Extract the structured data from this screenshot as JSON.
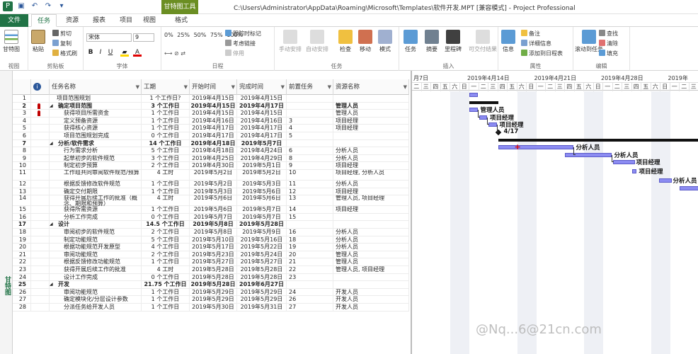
{
  "window": {
    "title": "C:\\Users\\Administrator\\AppData\\Roaming\\Microsoft\\Templates\\软件开发.MPT [兼容模式] - Project Professional",
    "context_tool": "甘特图工具"
  },
  "tabs": [
    {
      "label": "文件"
    },
    {
      "label": "任务"
    },
    {
      "label": "资源"
    },
    {
      "label": "报表"
    },
    {
      "label": "项目"
    },
    {
      "label": "视图"
    },
    {
      "label": "格式"
    }
  ],
  "ribbon": {
    "view": {
      "gantt_label": "甘特图",
      "group": "视图"
    },
    "clipboard": {
      "paste": "粘贴",
      "cut": "剪切",
      "copy": "复制",
      "format_painter": "格式刷",
      "group": "剪贴板"
    },
    "font": {
      "family": "宋体",
      "size": "9",
      "bold": "B",
      "italic": "I",
      "underline": "U",
      "group": "字体"
    },
    "schedule": {
      "pcts": [
        "0%",
        "25%",
        "50%",
        "75%",
        "100%"
      ],
      "track": "跟踪时标记",
      "respect_links": "考虑链接",
      "inactivate": "停用",
      "group": "日程"
    },
    "tasks": {
      "manual": "手动安排",
      "auto": "自动安排",
      "inspect": "检查",
      "move": "移动",
      "mode": "模式",
      "group": "任务"
    },
    "insert": {
      "task": "任务",
      "summary": "摘要",
      "milestone": "里程碑",
      "deliverable": "可交付结果",
      "group": "插入"
    },
    "properties": {
      "info": "信息",
      "notes": "备注",
      "details": "详细信息",
      "add_timeline": "添加到日程表",
      "group": "属性"
    },
    "editing": {
      "scroll": "滚动到任务",
      "find": "查找",
      "clear": "清除",
      "fill": "填充",
      "group": "编辑"
    }
  },
  "sidebar_label": "甘特图",
  "columns": [
    "任务名称",
    "工期",
    "开始时间",
    "完成时间",
    "前置任务",
    "资源名称"
  ],
  "rows": [
    {
      "id": "1",
      "name": "项目范围规划",
      "dur": "1 个工作日?",
      "start": "2019年4月15日",
      "finish": "2019年4月15日",
      "pred": "",
      "res": "",
      "lvl": 0,
      "sum": false
    },
    {
      "id": "2",
      "name": "确定项目范围",
      "dur": "3 个工作日",
      "start": "2019年4月15日",
      "finish": "2019年4月17日",
      "pred": "",
      "res": "管理人员",
      "lvl": 0,
      "sum": true,
      "ind": true
    },
    {
      "id": "3",
      "name": "获得项目所需资金",
      "dur": "1 个工作日",
      "start": "2019年4月15日",
      "finish": "2019年4月15日",
      "pred": "",
      "res": "管理人员",
      "lvl": 1,
      "sum": false,
      "ind": true
    },
    {
      "id": "4",
      "name": "定义预备资源",
      "dur": "1 个工作日",
      "start": "2019年4月16日",
      "finish": "2019年4月16日",
      "pred": "3",
      "res": "项目经理",
      "lvl": 1,
      "sum": false
    },
    {
      "id": "5",
      "name": "获得核心资源",
      "dur": "1 个工作日",
      "start": "2019年4月17日",
      "finish": "2019年4月17日",
      "pred": "4",
      "res": "项目经理",
      "lvl": 1,
      "sum": false
    },
    {
      "id": "6",
      "name": "项目范围规划完成",
      "dur": "0 个工作日",
      "start": "2019年4月17日",
      "finish": "2019年4月17日",
      "pred": "5",
      "res": "",
      "lvl": 1,
      "sum": false
    },
    {
      "id": "7",
      "name": "分析/软件需求",
      "dur": "14 个工作日",
      "start": "2019年4月18日",
      "finish": "2019年5月7日",
      "pred": "",
      "res": "",
      "lvl": 0,
      "sum": true
    },
    {
      "id": "8",
      "name": "行为需求分析",
      "dur": "5 个工作日",
      "start": "2019年4月18日",
      "finish": "2019年4月24日",
      "pred": "6",
      "res": "分析人员",
      "lvl": 1,
      "sum": false
    },
    {
      "id": "9",
      "name": "起草初步的软件规范",
      "dur": "3 个工作日",
      "start": "2019年4月25日",
      "finish": "2019年4月29日",
      "pred": "8",
      "res": "分析人员",
      "lvl": 1,
      "sum": false
    },
    {
      "id": "10",
      "name": "制定初步预算",
      "dur": "2 个工作日",
      "start": "2019年4月30日",
      "finish": "2019年5月1日",
      "pred": "9",
      "res": "项目经理",
      "lvl": 1,
      "sum": false
    },
    {
      "id": "11",
      "name": "工作组共同审阅软件规范/预算",
      "dur": "4 工时",
      "start": "2019年5月2日",
      "finish": "2019年5月2日",
      "pred": "10",
      "res": "项目经理, 分析人员",
      "lvl": 1,
      "sum": false,
      "tall": true
    },
    {
      "id": "12",
      "name": "根据反馈修改软件规范",
      "dur": "1 个工作日",
      "start": "2019年5月2日",
      "finish": "2019年5月3日",
      "pred": "11",
      "res": "分析人员",
      "lvl": 1,
      "sum": false
    },
    {
      "id": "13",
      "name": "确定交付期限",
      "dur": "1 个工作日",
      "start": "2019年5月3日",
      "finish": "2019年5月6日",
      "pred": "12",
      "res": "项目经理",
      "lvl": 1,
      "sum": false
    },
    {
      "id": "14",
      "name": "获得开展后续工作的批准（概念、期限和预算）",
      "dur": "4 工时",
      "start": "2019年5月6日",
      "finish": "2019年5月6日",
      "pred": "13",
      "res": "管理人员, 项目经理",
      "lvl": 1,
      "sum": false,
      "tall": true
    },
    {
      "id": "15",
      "name": "获得所需资源",
      "dur": "1 个工作日",
      "start": "2019年5月6日",
      "finish": "2019年5月7日",
      "pred": "14",
      "res": "项目经理",
      "lvl": 1,
      "sum": false
    },
    {
      "id": "16",
      "name": "分析工作完成",
      "dur": "0 个工作日",
      "start": "2019年5月7日",
      "finish": "2019年5月7日",
      "pred": "15",
      "res": "",
      "lvl": 1,
      "sum": false
    },
    {
      "id": "17",
      "name": "设计",
      "dur": "14.5 个工作日",
      "start": "2019年5月8日",
      "finish": "2019年5月28日",
      "pred": "",
      "res": "",
      "lvl": 0,
      "sum": true
    },
    {
      "id": "18",
      "name": "审阅初步的软件规范",
      "dur": "2 个工作日",
      "start": "2019年5月8日",
      "finish": "2019年5月9日",
      "pred": "16",
      "res": "分析人员",
      "lvl": 1,
      "sum": false
    },
    {
      "id": "19",
      "name": "制定功能规范",
      "dur": "5 个工作日",
      "start": "2019年5月10日",
      "finish": "2019年5月16日",
      "pred": "18",
      "res": "分析人员",
      "lvl": 1,
      "sum": false
    },
    {
      "id": "20",
      "name": "根据功能规范开发原型",
      "dur": "4 个工作日",
      "start": "2019年5月17日",
      "finish": "2019年5月22日",
      "pred": "19",
      "res": "分析人员",
      "lvl": 1,
      "sum": false
    },
    {
      "id": "21",
      "name": "审阅功能规范",
      "dur": "2 个工作日",
      "start": "2019年5月23日",
      "finish": "2019年5月24日",
      "pred": "20",
      "res": "管理人员",
      "lvl": 1,
      "sum": false
    },
    {
      "id": "22",
      "name": "根据反馈修改功能规范",
      "dur": "1 个工作日",
      "start": "2019年5月27日",
      "finish": "2019年5月27日",
      "pred": "21",
      "res": "管理人员",
      "lvl": 1,
      "sum": false
    },
    {
      "id": "23",
      "name": "获得开展后续工作的批准",
      "dur": "4 工时",
      "start": "2019年5月28日",
      "finish": "2019年5月28日",
      "pred": "22",
      "res": "管理人员, 项目经理",
      "lvl": 1,
      "sum": false
    },
    {
      "id": "24",
      "name": "设计工作完成",
      "dur": "0 个工作日",
      "start": "2019年5月28日",
      "finish": "2019年5月28日",
      "pred": "23",
      "res": "",
      "lvl": 1,
      "sum": false
    },
    {
      "id": "25",
      "name": "开发",
      "dur": "21.75 个工作日",
      "start": "2019年5月28日",
      "finish": "2019年6月27日",
      "pred": "",
      "res": "",
      "lvl": 0,
      "sum": true
    },
    {
      "id": "26",
      "name": "审阅功能规范",
      "dur": "1 个工作日",
      "start": "2019年5月29日",
      "finish": "2019年5月29日",
      "pred": "24",
      "res": "开发人员",
      "lvl": 1,
      "sum": false
    },
    {
      "id": "27",
      "name": "确定模块化/分层设计参数",
      "dur": "1 个工作日",
      "start": "2019年5月29日",
      "finish": "2019年5月29日",
      "pred": "26",
      "res": "开发人员",
      "lvl": 1,
      "sum": false
    },
    {
      "id": "28",
      "name": "分派任务给开发人员",
      "dur": "1 个工作日",
      "start": "2019年5月30日",
      "finish": "2019年5月31日",
      "pred": "27",
      "res": "开发人员",
      "lvl": 1,
      "sum": false
    }
  ],
  "gantt": {
    "weeks": [
      "月7日",
      "2019年4月14日",
      "2019年4月21日",
      "2019年4月28日",
      "2019年"
    ],
    "days": [
      "二",
      "三",
      "四",
      "五",
      "六",
      "日",
      "一",
      "二",
      "三",
      "四",
      "五",
      "六",
      "日",
      "一",
      "二",
      "三",
      "四",
      "五",
      "六",
      "日",
      "一",
      "二",
      "三",
      "四",
      "五",
      "六",
      "日",
      "一",
      "二",
      "三"
    ],
    "labels": {
      "r2": "管理人员",
      "r3": "项目经理",
      "r4": "项目经理",
      "milestone": "4/17",
      "r8": "分析人员",
      "r9": "分析人员",
      "r10": "项目经理",
      "r11": "项目经理",
      "r12": "分析人员"
    }
  },
  "watermark": "@Nq...6@21cn.com"
}
